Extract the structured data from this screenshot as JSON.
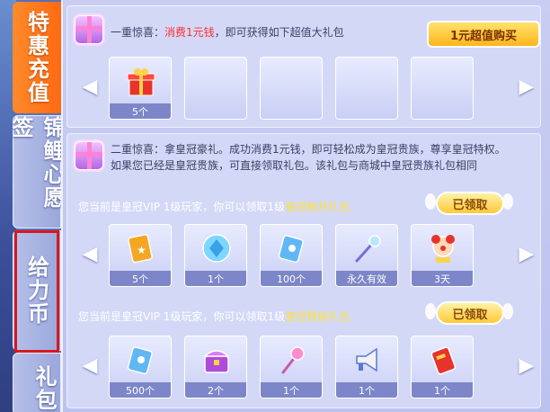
{
  "sidebar": {
    "tabs": [
      {
        "label": "特惠充值",
        "active": true
      },
      {
        "label": "锦鲤心愿签",
        "active": false
      },
      {
        "label": "给力币",
        "active": false
      },
      {
        "label": "礼包",
        "active": false
      }
    ]
  },
  "section1": {
    "prefix": "一重惊喜：",
    "highlight": "消费1元钱",
    "suffix": "，即可获得如下超值大礼包",
    "buy_button": "1元超值购买",
    "items": [
      {
        "icon": "red-gift-box-icon",
        "count": "5个"
      },
      {
        "icon": "empty-slot",
        "count": ""
      },
      {
        "icon": "empty-slot",
        "count": ""
      },
      {
        "icon": "empty-slot",
        "count": ""
      },
      {
        "icon": "empty-slot",
        "count": ""
      }
    ]
  },
  "section2": {
    "line1": "二重惊喜：拿皇冠豪礼。成功消费1元钱，即可轻松成为皇冠贵族，尊享皇冠特权。",
    "line2": "如果您已经是皇冠贵族，可直接领取礼包。该礼包与商城中皇冠贵族礼包相同",
    "monthly": {
      "text": "您当前是皇冠VIP 1级玩家，你可以领取1级",
      "highlight": "皇冠每月礼包",
      "badge": "已领取",
      "items": [
        {
          "icon": "gold-card-icon",
          "count": "5个"
        },
        {
          "icon": "blue-gem-icon",
          "count": "1个"
        },
        {
          "icon": "blue-ticket-icon",
          "count": "100个"
        },
        {
          "icon": "magic-wand-icon",
          "count": "永久有效"
        },
        {
          "icon": "clown-avatar-icon",
          "count": "3天"
        }
      ]
    },
    "upgrade": {
      "text": "您当前是皇冠VIP 1级玩家，你可以领取1级",
      "highlight": "皇冠晋级礼包",
      "badge": "已领取",
      "items": [
        {
          "icon": "blue-ticket-icon",
          "count": "500个"
        },
        {
          "icon": "purple-chest-icon",
          "count": "2个"
        },
        {
          "icon": "pink-wand-icon",
          "count": "1个"
        },
        {
          "icon": "megaphone-icon",
          "count": "1个"
        },
        {
          "icon": "red-card-icon",
          "count": "1个"
        }
      ]
    }
  },
  "colors": {
    "active_tab": "#ff7a1f",
    "highlight_red": "#ff2d2d",
    "highlight_yellow": "#ffe23a",
    "annotation_red": "#d8181c"
  }
}
